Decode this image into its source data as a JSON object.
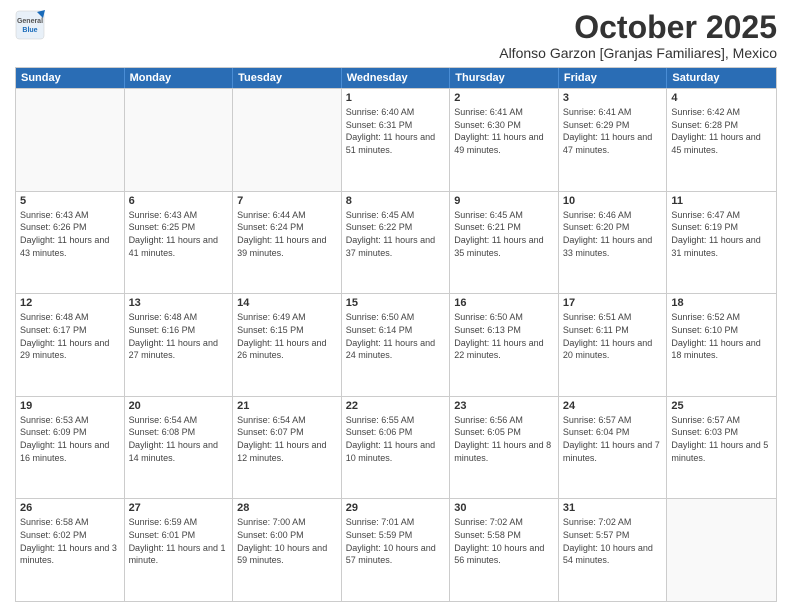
{
  "logo": {
    "general": "General",
    "blue": "Blue"
  },
  "title": "October 2025",
  "subtitle": "Alfonso Garzon [Granjas Familiares], Mexico",
  "headers": [
    "Sunday",
    "Monday",
    "Tuesday",
    "Wednesday",
    "Thursday",
    "Friday",
    "Saturday"
  ],
  "weeks": [
    [
      {
        "num": "",
        "sunrise": "",
        "sunset": "",
        "daylight": ""
      },
      {
        "num": "",
        "sunrise": "",
        "sunset": "",
        "daylight": ""
      },
      {
        "num": "",
        "sunrise": "",
        "sunset": "",
        "daylight": ""
      },
      {
        "num": "1",
        "sunrise": "Sunrise: 6:40 AM",
        "sunset": "Sunset: 6:31 PM",
        "daylight": "Daylight: 11 hours and 51 minutes."
      },
      {
        "num": "2",
        "sunrise": "Sunrise: 6:41 AM",
        "sunset": "Sunset: 6:30 PM",
        "daylight": "Daylight: 11 hours and 49 minutes."
      },
      {
        "num": "3",
        "sunrise": "Sunrise: 6:41 AM",
        "sunset": "Sunset: 6:29 PM",
        "daylight": "Daylight: 11 hours and 47 minutes."
      },
      {
        "num": "4",
        "sunrise": "Sunrise: 6:42 AM",
        "sunset": "Sunset: 6:28 PM",
        "daylight": "Daylight: 11 hours and 45 minutes."
      }
    ],
    [
      {
        "num": "5",
        "sunrise": "Sunrise: 6:43 AM",
        "sunset": "Sunset: 6:26 PM",
        "daylight": "Daylight: 11 hours and 43 minutes."
      },
      {
        "num": "6",
        "sunrise": "Sunrise: 6:43 AM",
        "sunset": "Sunset: 6:25 PM",
        "daylight": "Daylight: 11 hours and 41 minutes."
      },
      {
        "num": "7",
        "sunrise": "Sunrise: 6:44 AM",
        "sunset": "Sunset: 6:24 PM",
        "daylight": "Daylight: 11 hours and 39 minutes."
      },
      {
        "num": "8",
        "sunrise": "Sunrise: 6:45 AM",
        "sunset": "Sunset: 6:22 PM",
        "daylight": "Daylight: 11 hours and 37 minutes."
      },
      {
        "num": "9",
        "sunrise": "Sunrise: 6:45 AM",
        "sunset": "Sunset: 6:21 PM",
        "daylight": "Daylight: 11 hours and 35 minutes."
      },
      {
        "num": "10",
        "sunrise": "Sunrise: 6:46 AM",
        "sunset": "Sunset: 6:20 PM",
        "daylight": "Daylight: 11 hours and 33 minutes."
      },
      {
        "num": "11",
        "sunrise": "Sunrise: 6:47 AM",
        "sunset": "Sunset: 6:19 PM",
        "daylight": "Daylight: 11 hours and 31 minutes."
      }
    ],
    [
      {
        "num": "12",
        "sunrise": "Sunrise: 6:48 AM",
        "sunset": "Sunset: 6:17 PM",
        "daylight": "Daylight: 11 hours and 29 minutes."
      },
      {
        "num": "13",
        "sunrise": "Sunrise: 6:48 AM",
        "sunset": "Sunset: 6:16 PM",
        "daylight": "Daylight: 11 hours and 27 minutes."
      },
      {
        "num": "14",
        "sunrise": "Sunrise: 6:49 AM",
        "sunset": "Sunset: 6:15 PM",
        "daylight": "Daylight: 11 hours and 26 minutes."
      },
      {
        "num": "15",
        "sunrise": "Sunrise: 6:50 AM",
        "sunset": "Sunset: 6:14 PM",
        "daylight": "Daylight: 11 hours and 24 minutes."
      },
      {
        "num": "16",
        "sunrise": "Sunrise: 6:50 AM",
        "sunset": "Sunset: 6:13 PM",
        "daylight": "Daylight: 11 hours and 22 minutes."
      },
      {
        "num": "17",
        "sunrise": "Sunrise: 6:51 AM",
        "sunset": "Sunset: 6:11 PM",
        "daylight": "Daylight: 11 hours and 20 minutes."
      },
      {
        "num": "18",
        "sunrise": "Sunrise: 6:52 AM",
        "sunset": "Sunset: 6:10 PM",
        "daylight": "Daylight: 11 hours and 18 minutes."
      }
    ],
    [
      {
        "num": "19",
        "sunrise": "Sunrise: 6:53 AM",
        "sunset": "Sunset: 6:09 PM",
        "daylight": "Daylight: 11 hours and 16 minutes."
      },
      {
        "num": "20",
        "sunrise": "Sunrise: 6:54 AM",
        "sunset": "Sunset: 6:08 PM",
        "daylight": "Daylight: 11 hours and 14 minutes."
      },
      {
        "num": "21",
        "sunrise": "Sunrise: 6:54 AM",
        "sunset": "Sunset: 6:07 PM",
        "daylight": "Daylight: 11 hours and 12 minutes."
      },
      {
        "num": "22",
        "sunrise": "Sunrise: 6:55 AM",
        "sunset": "Sunset: 6:06 PM",
        "daylight": "Daylight: 11 hours and 10 minutes."
      },
      {
        "num": "23",
        "sunrise": "Sunrise: 6:56 AM",
        "sunset": "Sunset: 6:05 PM",
        "daylight": "Daylight: 11 hours and 8 minutes."
      },
      {
        "num": "24",
        "sunrise": "Sunrise: 6:57 AM",
        "sunset": "Sunset: 6:04 PM",
        "daylight": "Daylight: 11 hours and 7 minutes."
      },
      {
        "num": "25",
        "sunrise": "Sunrise: 6:57 AM",
        "sunset": "Sunset: 6:03 PM",
        "daylight": "Daylight: 11 hours and 5 minutes."
      }
    ],
    [
      {
        "num": "26",
        "sunrise": "Sunrise: 6:58 AM",
        "sunset": "Sunset: 6:02 PM",
        "daylight": "Daylight: 11 hours and 3 minutes."
      },
      {
        "num": "27",
        "sunrise": "Sunrise: 6:59 AM",
        "sunset": "Sunset: 6:01 PM",
        "daylight": "Daylight: 11 hours and 1 minute."
      },
      {
        "num": "28",
        "sunrise": "Sunrise: 7:00 AM",
        "sunset": "Sunset: 6:00 PM",
        "daylight": "Daylight: 10 hours and 59 minutes."
      },
      {
        "num": "29",
        "sunrise": "Sunrise: 7:01 AM",
        "sunset": "Sunset: 5:59 PM",
        "daylight": "Daylight: 10 hours and 57 minutes."
      },
      {
        "num": "30",
        "sunrise": "Sunrise: 7:02 AM",
        "sunset": "Sunset: 5:58 PM",
        "daylight": "Daylight: 10 hours and 56 minutes."
      },
      {
        "num": "31",
        "sunrise": "Sunrise: 7:02 AM",
        "sunset": "Sunset: 5:57 PM",
        "daylight": "Daylight: 10 hours and 54 minutes."
      },
      {
        "num": "",
        "sunrise": "",
        "sunset": "",
        "daylight": ""
      }
    ]
  ]
}
